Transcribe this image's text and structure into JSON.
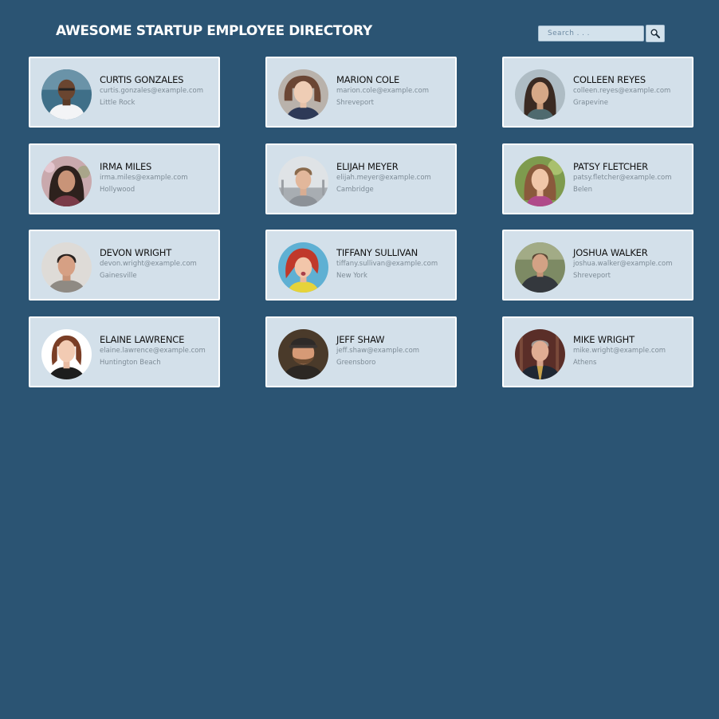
{
  "header": {
    "title": "AWESOME STARTUP EMPLOYEE DIRECTORY"
  },
  "search": {
    "placeholder": "Search . . .",
    "button_icon": "magnifier-icon"
  },
  "colors": {
    "background": "#2b5473",
    "card": "#d3e0ea",
    "card_border": "#ffffff",
    "name_text": "#111111",
    "meta_text": "#7d8b96"
  },
  "employees": [
    {
      "name": "CURTIS GONZALES",
      "email": "curtis.gonzales@example.com",
      "city": "Little Rock"
    },
    {
      "name": "MARION COLE",
      "email": "marion.cole@example.com",
      "city": "Shreveport"
    },
    {
      "name": "COLLEEN REYES",
      "email": "colleen.reyes@example.com",
      "city": "Grapevine"
    },
    {
      "name": "IRMA MILES",
      "email": "irma.miles@example.com",
      "city": "Hollywood"
    },
    {
      "name": "ELIJAH MEYER",
      "email": "elijah.meyer@example.com",
      "city": "Cambridge"
    },
    {
      "name": "PATSY FLETCHER",
      "email": "patsy.fletcher@example.com",
      "city": "Belen"
    },
    {
      "name": "DEVON WRIGHT",
      "email": "devon.wright@example.com",
      "city": "Gainesville"
    },
    {
      "name": "TIFFANY SULLIVAN",
      "email": "tiffany.sullivan@example.com",
      "city": "New York"
    },
    {
      "name": "JOSHUA WALKER",
      "email": "joshua.walker@example.com",
      "city": "Shreveport"
    },
    {
      "name": "ELAINE LAWRENCE",
      "email": "elaine.lawrence@example.com",
      "city": "Huntington Beach"
    },
    {
      "name": "JEFF SHAW",
      "email": "jeff.shaw@example.com",
      "city": "Greensboro"
    },
    {
      "name": "MIKE WRIGHT",
      "email": "mike.wright@example.com",
      "city": "Athens"
    }
  ]
}
